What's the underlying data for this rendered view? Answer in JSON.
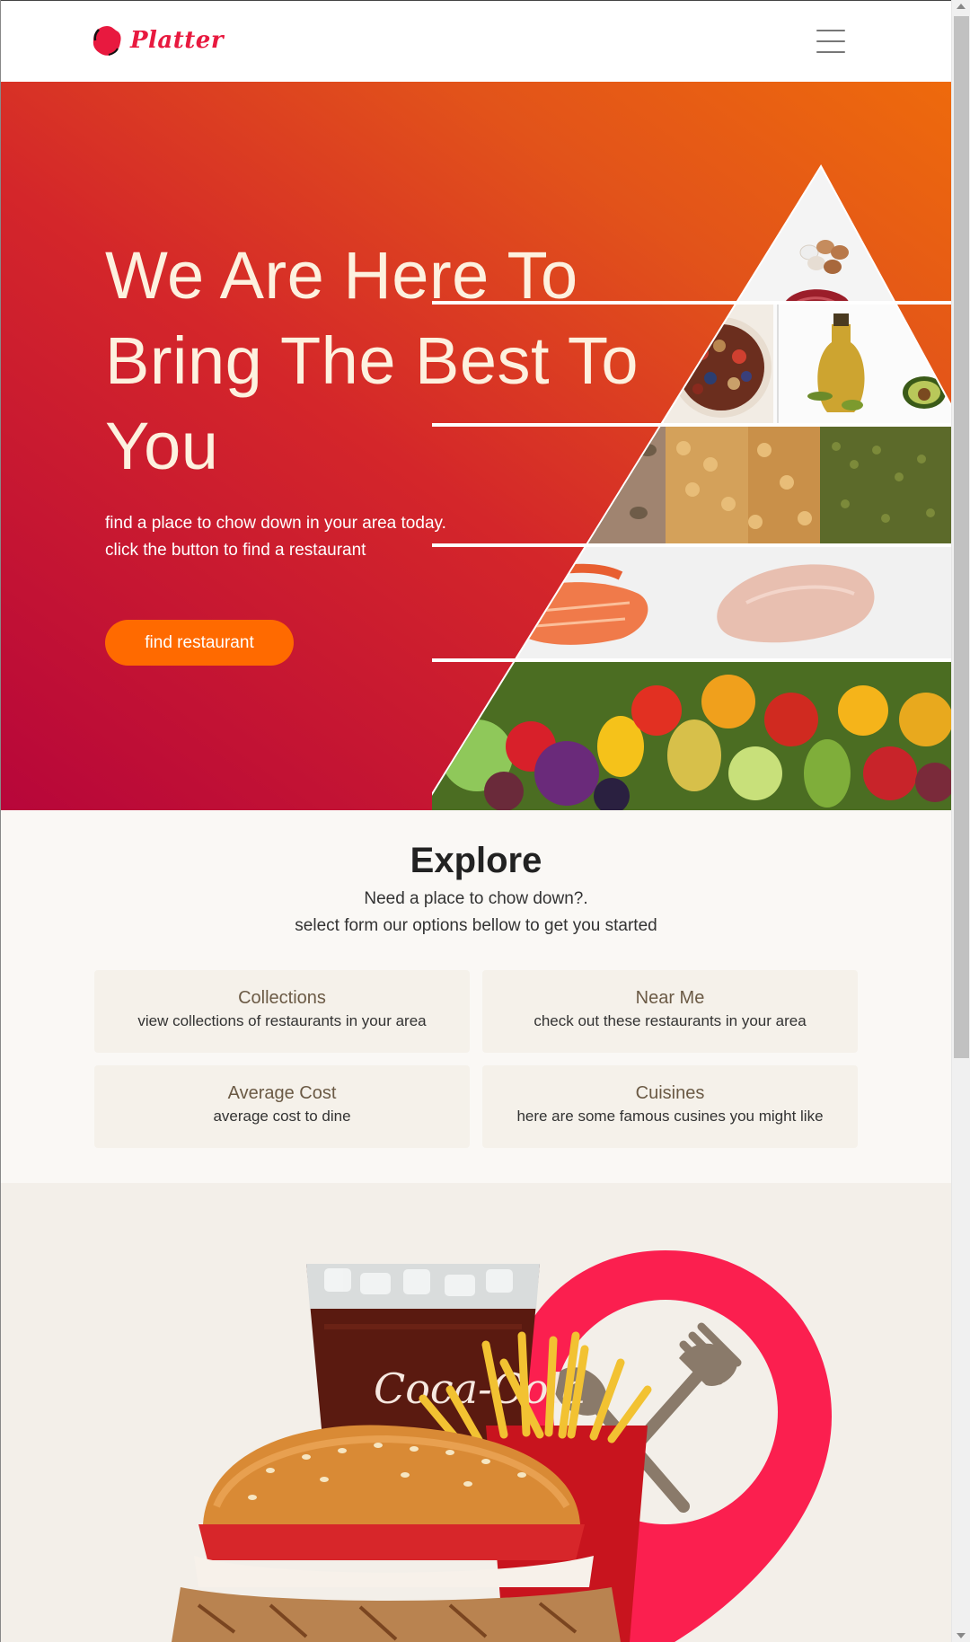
{
  "brand": {
    "name": "Platter",
    "logo_icon": "blob-logo-icon",
    "color": "#e8193f"
  },
  "nav": {
    "menu_icon": "hamburger-menu-icon"
  },
  "hero": {
    "title": "We Are Here To Bring The Best To You",
    "subtitle_line1": "find a place to chow down in your area today.",
    "subtitle_line2": "click the button to find a restaurant",
    "button_label": "find restaurant",
    "image": "food-pyramid-image",
    "gradient_colors": [
      "#b7063a",
      "#ee6a0c"
    ],
    "button_color": "#ff6a00"
  },
  "explore": {
    "title": "Explore",
    "subtitle_line1": "Need a place to chow down?.",
    "subtitle_line2": "select form our options bellow to get you started",
    "cards": [
      {
        "title": "Collections",
        "description": "view collections of restaurants in your area"
      },
      {
        "title": "Near Me",
        "description": "check out these restaurants in your area"
      },
      {
        "title": "Average Cost",
        "description": "average cost to dine"
      },
      {
        "title": "Cuisines",
        "description": "here are some famous cusines you might like"
      }
    ]
  },
  "promo": {
    "image": "burger-fries-drink-image",
    "drink_text": "Coca-Cola",
    "pin_icon": "location-pin-cutlery-icon",
    "pin_color": "#fb1f4f"
  }
}
